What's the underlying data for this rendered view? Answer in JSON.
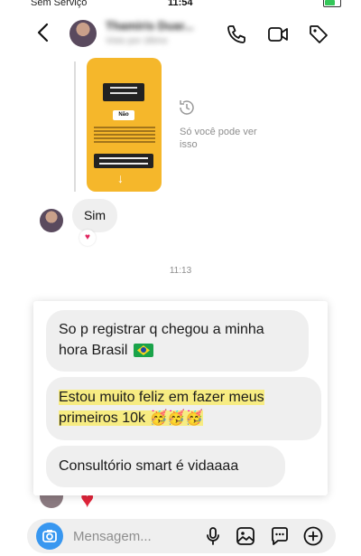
{
  "status_bar": {
    "carrier": "Sem Serviço",
    "time": "11:54"
  },
  "header": {
    "name": "Thamiris Duar...",
    "subtitle": "Visto por último"
  },
  "story": {
    "badge": "Não",
    "expired_note": "Só você pode ver isso"
  },
  "messages": {
    "sim": "Sim",
    "time_separator": "11:13",
    "m1": "So p registrar q chegou a minha hora Brasil",
    "m2": "Estou muito feliz em fazer meus primeiros 10k",
    "m2_emojis": "🥳🥳🥳",
    "m3": "Consultório smart é vidaaaa"
  },
  "composer": {
    "placeholder": "Mensagem..."
  },
  "colors": {
    "accent": "#3897f0",
    "bubble": "#efefef",
    "highlight": "#f7ec82",
    "story_bg": "#f5b72b",
    "heart": "#e0243a"
  },
  "icons": [
    "back-icon",
    "phone-icon",
    "video-icon",
    "tag-icon",
    "expired-story-icon",
    "camera-icon",
    "mic-icon",
    "gallery-icon",
    "sticker-icon",
    "plus-icon",
    "heart-reaction-icon",
    "wifi-icon",
    "battery-icon"
  ]
}
